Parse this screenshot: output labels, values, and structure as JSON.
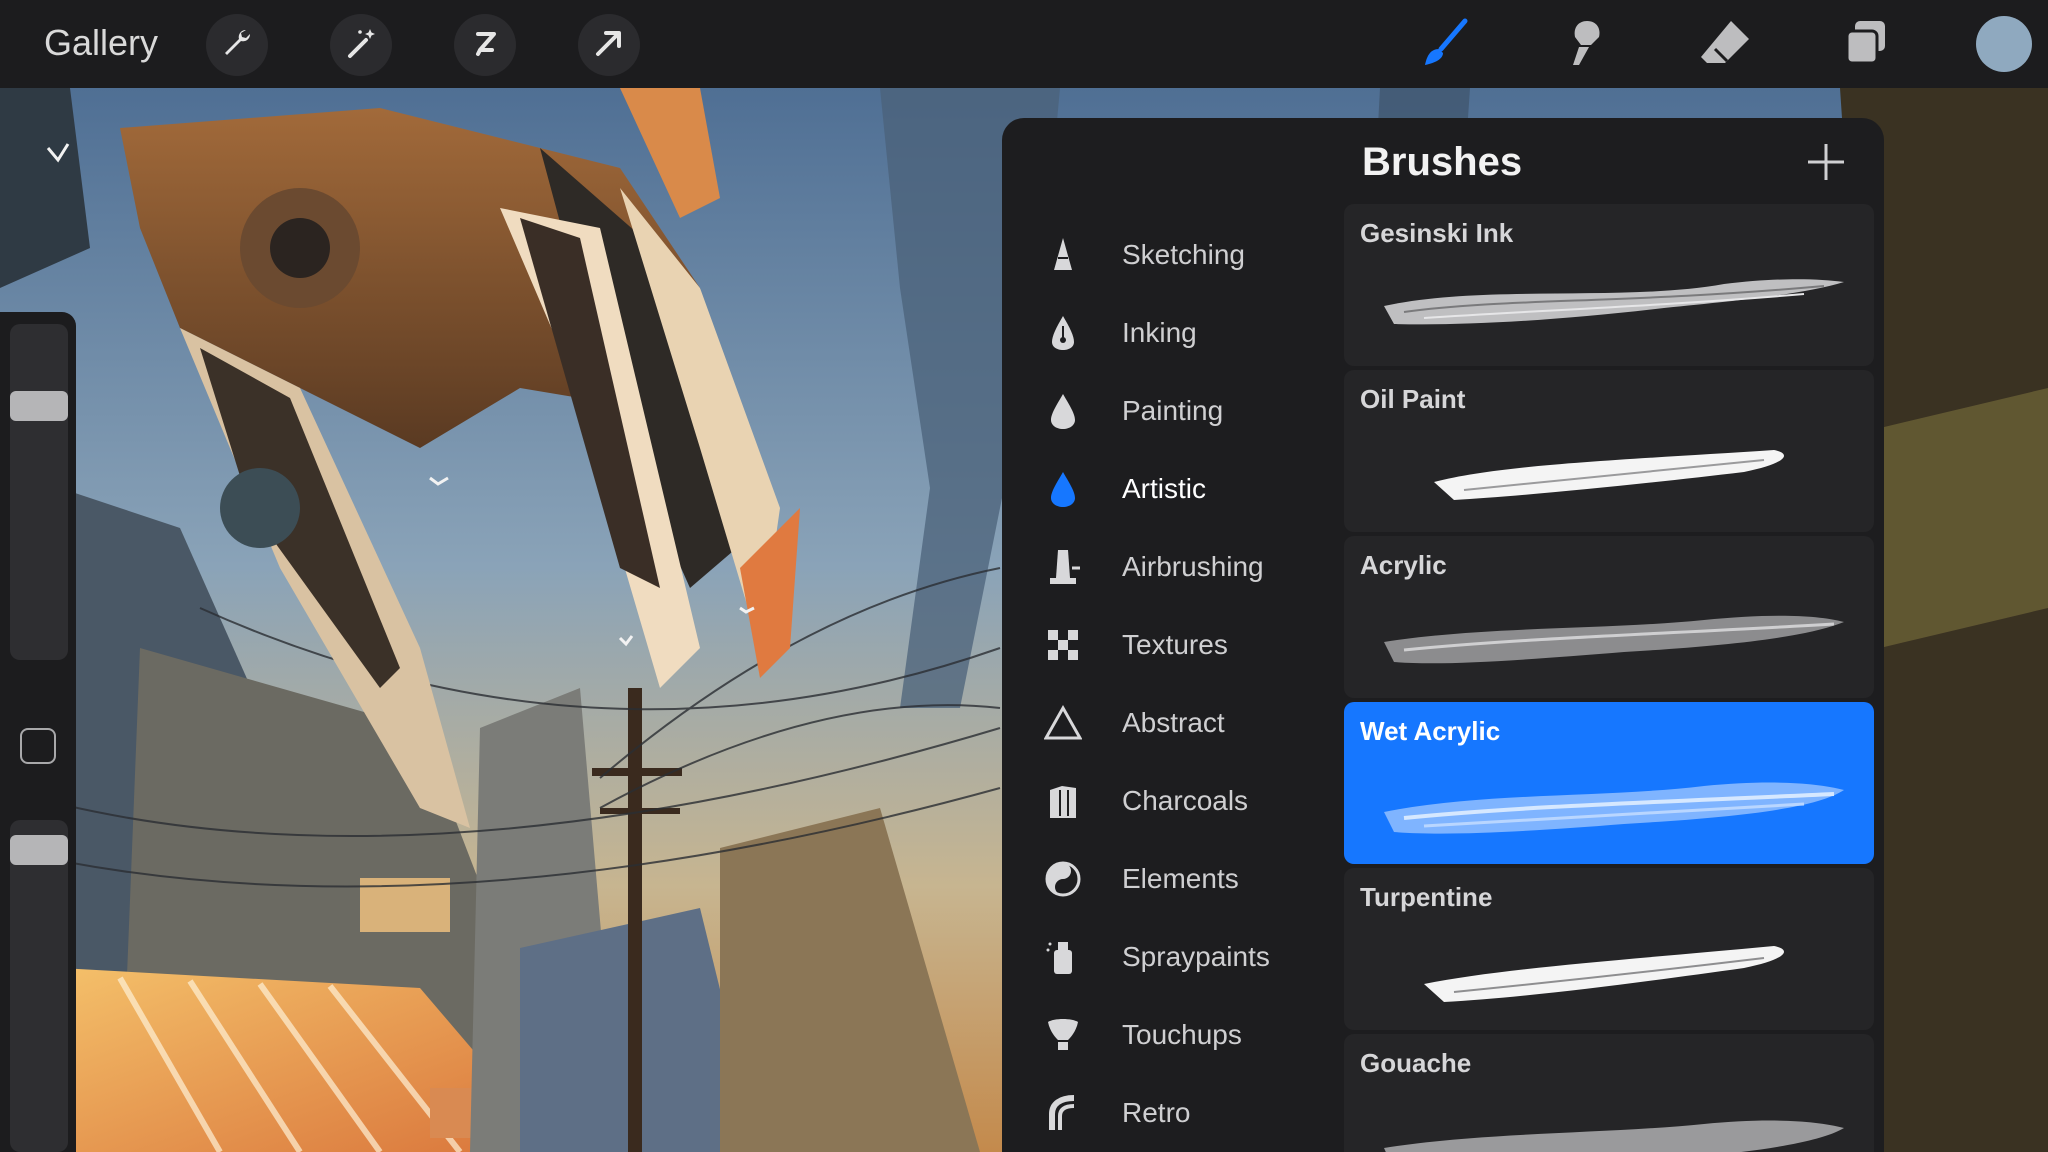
{
  "topbar": {
    "gallery_label": "Gallery",
    "left_tools": [
      {
        "name": "wrench-icon"
      },
      {
        "name": "magic-wand-icon"
      },
      {
        "name": "selection-icon"
      },
      {
        "name": "move-arrow-icon"
      }
    ],
    "right_tools": [
      {
        "name": "brush-icon",
        "color": "#1677ff"
      },
      {
        "name": "smudge-icon",
        "color": "#bdbdbf"
      },
      {
        "name": "eraser-icon",
        "color": "#bdbdbf"
      },
      {
        "name": "layers-icon",
        "color": "#bdbdbf"
      }
    ],
    "current_color": "#8fa9bf"
  },
  "brush_panel": {
    "title": "Brushes",
    "sets": [
      {
        "label": "Sketching",
        "icon": "pencil-tip-icon"
      },
      {
        "label": "Inking",
        "icon": "pen-nib-icon"
      },
      {
        "label": "Painting",
        "icon": "drop-icon"
      },
      {
        "label": "Artistic",
        "icon": "drop-icon",
        "selected": true
      },
      {
        "label": "Airbrushing",
        "icon": "airbrush-icon"
      },
      {
        "label": "Textures",
        "icon": "checker-icon"
      },
      {
        "label": "Abstract",
        "icon": "triangle-icon"
      },
      {
        "label": "Charcoals",
        "icon": "charcoal-icon"
      },
      {
        "label": "Elements",
        "icon": "yin-yang-icon"
      },
      {
        "label": "Spraypaints",
        "icon": "spray-can-icon"
      },
      {
        "label": "Touchups",
        "icon": "touchup-icon"
      },
      {
        "label": "Retro",
        "icon": "retro-icon"
      }
    ],
    "brushes": [
      {
        "name": "Gesinski Ink"
      },
      {
        "name": "Oil Paint"
      },
      {
        "name": "Acrylic"
      },
      {
        "name": "Wet Acrylic",
        "selected": true
      },
      {
        "name": "Turpentine"
      },
      {
        "name": "Gouache"
      }
    ],
    "accent_color": "#1677ff"
  },
  "sidebar": {
    "brush_size_level": 0.22,
    "opacity_level": 0.05
  }
}
